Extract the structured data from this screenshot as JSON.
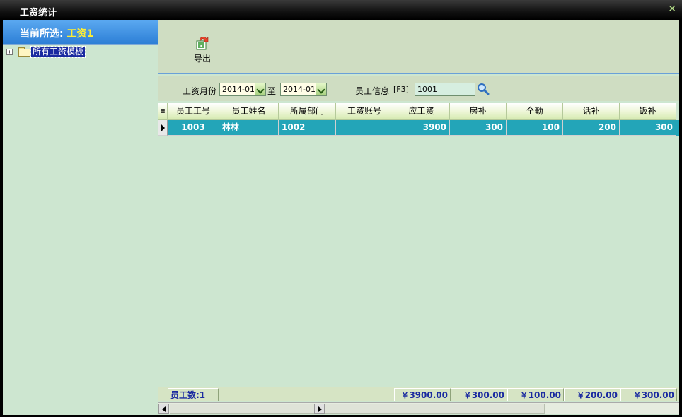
{
  "window": {
    "title": "工资统计",
    "close_icon": "close-icon"
  },
  "left": {
    "current_label": "当前所选:",
    "current_value": "工资1",
    "tree": {
      "expander": "+",
      "label": "所有工资模板"
    }
  },
  "toolbar": {
    "export_label": "导出"
  },
  "filter": {
    "month_label": "工资月份",
    "from_value": "2014-01",
    "to_label": "至",
    "to_value": "2014-01",
    "employee_label": "员工信息",
    "hotkey": "[F3]",
    "employee_value": "1001"
  },
  "grid": {
    "columns": [
      "员工工号",
      "员工姓名",
      "所属部门",
      "工资账号",
      "应工资",
      "房补",
      "全勤",
      "话补",
      "饭补"
    ],
    "header_indicator": "≣",
    "rows": [
      {
        "emp_no": "1003",
        "name": "林林",
        "dept": "1002",
        "account": "",
        "gross": "3900",
        "housing": "300",
        "attendance": "100",
        "phone": "200",
        "meal": "300"
      }
    ]
  },
  "footer": {
    "count_label": "员工数:1",
    "gross_total": "￥3900.00",
    "housing_total": "￥300.00",
    "attendance_total": "￥100.00",
    "phone_total": "￥200.00",
    "meal_total": "￥300.00"
  },
  "colors": {
    "selected_row": "#23a5b8",
    "panel_bg": "#cde6d0",
    "header_blue": "#2d7fd6",
    "highlight_yellow": "#ffee33"
  }
}
